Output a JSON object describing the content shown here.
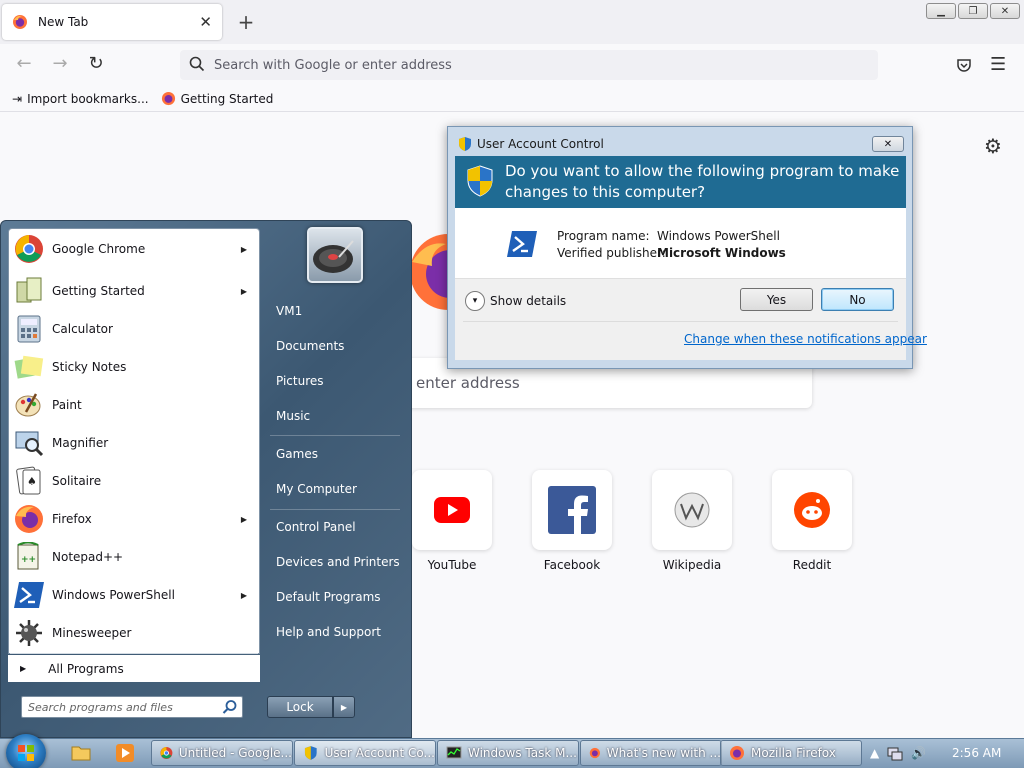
{
  "browser": {
    "tab_title": "New Tab",
    "url_placeholder": "Search with Google or enter address",
    "bookmarks": [
      "Import bookmarks...",
      "Getting Started"
    ],
    "content_search_placeholder": "enter address",
    "shortcuts": [
      {
        "label": "YouTube",
        "icon": "youtube-icon"
      },
      {
        "label": "Facebook",
        "icon": "facebook-icon"
      },
      {
        "label": "Wikipedia",
        "icon": "wikipedia-icon"
      },
      {
        "label": "Reddit",
        "icon": "reddit-icon"
      }
    ]
  },
  "start_menu": {
    "programs": [
      {
        "label": "Google Chrome",
        "has_submenu": true
      },
      {
        "label": "Getting Started",
        "has_submenu": true
      },
      {
        "label": "Calculator",
        "has_submenu": false
      },
      {
        "label": "Sticky Notes",
        "has_submenu": false
      },
      {
        "label": "Paint",
        "has_submenu": false
      },
      {
        "label": "Magnifier",
        "has_submenu": false
      },
      {
        "label": "Solitaire",
        "has_submenu": false
      },
      {
        "label": "Firefox",
        "has_submenu": true
      },
      {
        "label": "Notepad++",
        "has_submenu": false
      },
      {
        "label": "Windows PowerShell",
        "has_submenu": true
      },
      {
        "label": "Minesweeper",
        "has_submenu": false
      }
    ],
    "all_programs": "All Programs",
    "search_placeholder": "Search programs and files",
    "right_items": [
      "VM1",
      "Documents",
      "Pictures",
      "Music",
      "Games",
      "My Computer",
      "Control Panel",
      "Devices and Printers",
      "Default Programs",
      "Help and Support"
    ],
    "lock_label": "Lock"
  },
  "uac": {
    "title": "User Account Control",
    "question": "Do you want to allow the following program to make changes to this computer?",
    "program_name_label": "Program name:",
    "program_name": "Windows PowerShell",
    "publisher_label": "Verified publisher:",
    "publisher": "Microsoft Windows",
    "show_details": "Show details",
    "yes": "Yes",
    "no": "No",
    "notifications_link": "Change when these notifications appear"
  },
  "taskbar": {
    "tasks": [
      "Untitled - Google...",
      "User Account Co...",
      "Windows Task M...",
      "What's new with ...",
      "Mozilla Firefox"
    ],
    "clock": "2:56 AM"
  }
}
